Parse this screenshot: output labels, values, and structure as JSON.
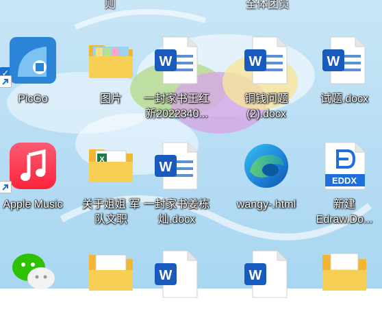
{
  "top_labels": [
    "则",
    "全体团员"
  ],
  "icons": [
    {
      "name": "picgo-icon",
      "label": "PicGo",
      "shortcut": true,
      "selected": true
    },
    {
      "name": "folder-icon",
      "label": "图片"
    },
    {
      "name": "word-doc-icon",
      "label": "一封家书王红\n新2022340..."
    },
    {
      "name": "word-doc-icon",
      "label": "铜钱问题\n(2).docx"
    },
    {
      "name": "word-doc-icon",
      "label": "试题.docx"
    },
    {
      "name": "apple-music-icon",
      "label": "Apple Music",
      "shortcut": true
    },
    {
      "name": "folder-icon",
      "label": "关于姐姐 军\n队文职"
    },
    {
      "name": "word-doc-icon",
      "label": "一封家书姜栋\n灿.docx"
    },
    {
      "name": "edge-icon",
      "label": "wangy-.html"
    },
    {
      "name": "edraw-icon",
      "label": "新建\nEdraw.Do...",
      "badge": "EDDX"
    }
  ],
  "colors": {
    "wallpaper": "#b9def4",
    "word_blue": "#185abd",
    "folder": "#f6c343"
  }
}
